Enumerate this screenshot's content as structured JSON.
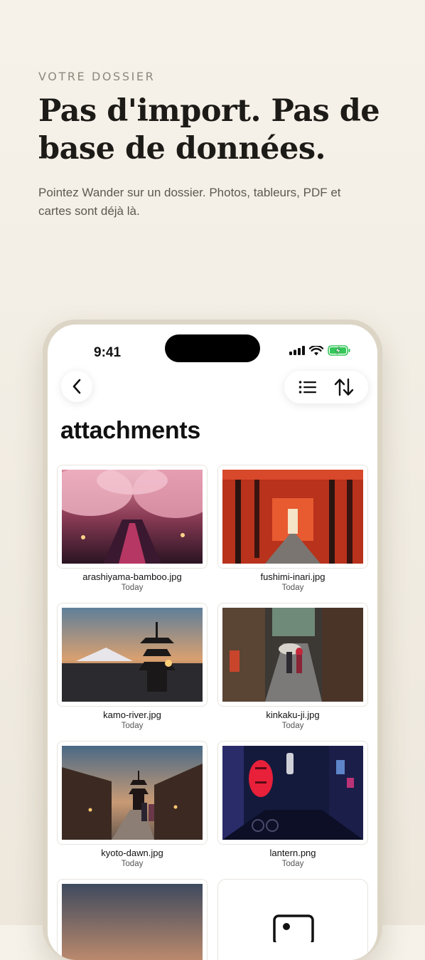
{
  "hero": {
    "eyebrow": "VOTRE DOSSIER",
    "headline": "Pas d'import. Pas de base de données.",
    "subtitle": "Pointez Wander sur un dossier. Photos, tableurs, PDF et cartes sont déjà là."
  },
  "status_bar": {
    "time": "9:41",
    "icons": [
      "signal-icon",
      "wifi-icon",
      "battery-charging-icon"
    ],
    "battery_color": "#34c759"
  },
  "nav": {
    "back_icon": "chevron-left-icon",
    "list_view_icon": "list-icon",
    "sort_icon": "sort-arrows-icon"
  },
  "folder": {
    "title": "attachments",
    "files": [
      {
        "name": "arashiyama-bamboo.jpg",
        "date": "Today"
      },
      {
        "name": "fushimi-inari.jpg",
        "date": "Today"
      },
      {
        "name": "kamo-river.jpg",
        "date": "Today"
      },
      {
        "name": "kinkaku-ji.jpg",
        "date": "Today"
      },
      {
        "name": "kyoto-dawn.jpg",
        "date": "Today"
      },
      {
        "name": "lantern.png",
        "date": "Today"
      }
    ]
  },
  "colors": {
    "background": "#f3eee6",
    "headline": "#1d1b17",
    "phone_frame": "#dcd5c5"
  }
}
